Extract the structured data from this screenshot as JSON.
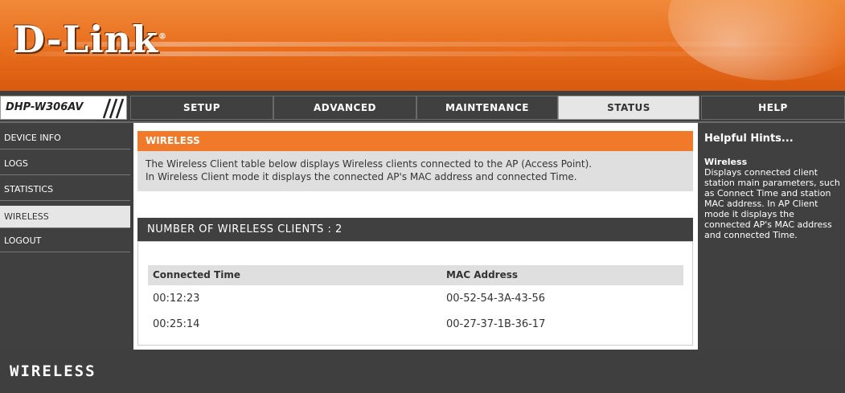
{
  "brand": {
    "logo": "D-Link",
    "reg": "®"
  },
  "model": "DHP-W306AV",
  "nav": {
    "tabs": [
      {
        "label": "SETUP",
        "active": false
      },
      {
        "label": "ADVANCED",
        "active": false
      },
      {
        "label": "MAINTENANCE",
        "active": false
      },
      {
        "label": "STATUS",
        "active": true
      },
      {
        "label": "HELP",
        "active": false
      }
    ]
  },
  "sidebar": {
    "items": [
      {
        "label": "DEVICE INFO",
        "active": false
      },
      {
        "label": "LOGS",
        "active": false
      },
      {
        "label": "STATISTICS",
        "active": false
      },
      {
        "label": "WIRELESS",
        "active": true
      },
      {
        "label": "LOGOUT",
        "active": false
      }
    ]
  },
  "main": {
    "section_title": "WIRELESS",
    "description_line1": "The Wireless Client table below displays Wireless clients connected to the AP (Access Point).",
    "description_line2": "In Wireless Client mode it displays the connected AP's MAC address and connected Time.",
    "clients_label": "NUMBER OF WIRELESS CLIENTS  :  2",
    "table": {
      "headers": [
        "Connected Time",
        "MAC Address"
      ],
      "rows": [
        [
          "00:12:23",
          "00-52-54-3A-43-56"
        ],
        [
          "00:25:14",
          "00-27-37-1B-36-17"
        ]
      ]
    }
  },
  "help": {
    "title": "Helpful Hints...",
    "subtitle": "Wireless",
    "text": "Displays connected client station main parameters, such as Connect Time and station MAC address. In AP Client mode it displays the connected AP's MAC address and connected Time."
  },
  "footer": {
    "label": "WIRELESS"
  },
  "colors": {
    "orange": "#f07a2a",
    "dark_gray": "#404040",
    "light_gray": "#dfdfdf",
    "active_tab": "#e6e6e6"
  }
}
